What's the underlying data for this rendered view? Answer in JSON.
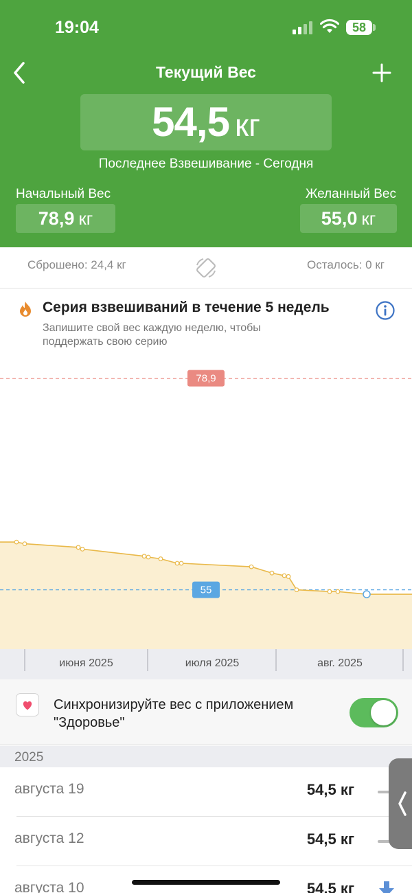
{
  "status_bar": {
    "time": "19:04",
    "battery": "58"
  },
  "header": {
    "title": "Текущий Вес",
    "current_weight": "54,5",
    "unit": "кг",
    "last_weighing": "Последнее Взвешивание - Сегодня",
    "start_label": "Начальный Вес",
    "start_value": "78,9",
    "goal_label": "Желанный Вес",
    "goal_value": "55,0"
  },
  "stats": {
    "lost": "Сброшено: 24,4 кг",
    "remaining": "Осталось: 0 кг"
  },
  "streak": {
    "title": "Серия взвешиваний в течение 5 недель",
    "description": "Запишите свой вес каждую неделю, чтобы поддержать свою серию"
  },
  "chart_data": {
    "type": "area",
    "series": [
      {
        "x": [
          "2025-05-21",
          "2025-05-23",
          "2025-06-05",
          "2025-06-06",
          "2025-06-21",
          "2025-06-22",
          "2025-06-25",
          "2025-06-29",
          "2025-06-30",
          "2025-07-17",
          "2025-07-22",
          "2025-07-25",
          "2025-07-26",
          "2025-07-28",
          "2025-08-05",
          "2025-08-07",
          "2025-08-14"
        ],
        "values": [
          60.4,
          60.2,
          59.8,
          59.6,
          58.8,
          58.7,
          58.5,
          58.0,
          58.0,
          57.6,
          56.9,
          56.6,
          56.5,
          55.0,
          54.8,
          54.8,
          54.5
        ]
      }
    ],
    "reference_lines": [
      {
        "value": 78.9,
        "label": "78,9",
        "color": "#ea8a82"
      },
      {
        "value": 55,
        "label": "55",
        "color": "#5ba7e2"
      }
    ],
    "x_tick_labels": [
      "июня 2025",
      "июля 2025",
      "авг. 2025"
    ],
    "line_color": "#e9b94a",
    "fill_color": "#fbefd2"
  },
  "sync": {
    "text": "Синхронизируйте вес с приложением \"Здоровье\"",
    "enabled": true
  },
  "history": {
    "year": "2025",
    "entries": [
      {
        "date": "августа 19",
        "weight": "54,5 кг",
        "trend": "flat"
      },
      {
        "date": "августа 12",
        "weight": "54,5 кг",
        "trend": "flat"
      },
      {
        "date": "августа 10",
        "weight": "54,5 кг",
        "trend": "down"
      }
    ]
  }
}
